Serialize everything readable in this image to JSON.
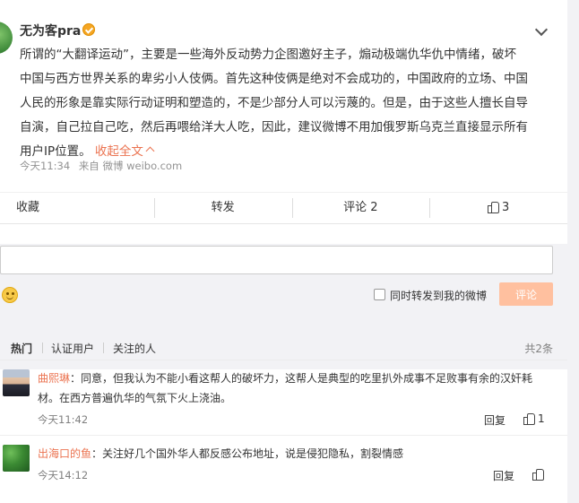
{
  "post": {
    "username": "无为客pra",
    "text_line1": "所谓的“大翻译运动”，主要是一些海外反动势力企图邀好主子，煽动极端仇华仇中情绪，破坏",
    "text_line2": "中国与西方世界关系的卑劣小人伎俩。首先这种伎俩是绝对不会成功的，中国政府的立场、中国",
    "text_line3": "人民的形象是靠实际行动证明和塑造的，不是少部分人可以污蔑的。但是，由于这些人擅长自导",
    "text_line4": "自演，自己拉自己吃，然后再喂给洋大人吃，因此，建议微博不用加俄罗斯乌克兰直接显示所有",
    "text_line5": "用户IP位置。",
    "collapse_label": "收起全文",
    "time": "今天11:34",
    "source": "来自 微博 weibo.com"
  },
  "actions": {
    "favorite": "收藏",
    "repost": "转发",
    "comment": "评论 2",
    "like_count": "3"
  },
  "composer": {
    "input_value": "",
    "forward_label": "同时转发到我的微博",
    "submit_label": "评论"
  },
  "comment_tabs": {
    "hot": "热门",
    "verified": "认证用户",
    "following": "关注的人",
    "total": "共2条"
  },
  "comments": [
    {
      "author": "曲熙琳",
      "text_line1": "：同意，但我认为不能小看这帮人的破坏力，这帮人是典型的吃里扒外成事不足败事有余的汉奸耗",
      "text_line2": "材。在西方普遍仇华的气氛下火上浇油。",
      "time": "今天11:42",
      "reply": "回复",
      "likes": "1"
    },
    {
      "author": "出海口的鱼",
      "text_line1": "：关注好几个国外华人都反感公布地址，说是侵犯隐私，割裂情感",
      "time": "今天14:12",
      "reply": "回复",
      "likes": ""
    }
  ],
  "colors": {
    "accent": "#eb7350",
    "submit_disabled": "#ffc09f",
    "background": "#f2f2f5"
  }
}
